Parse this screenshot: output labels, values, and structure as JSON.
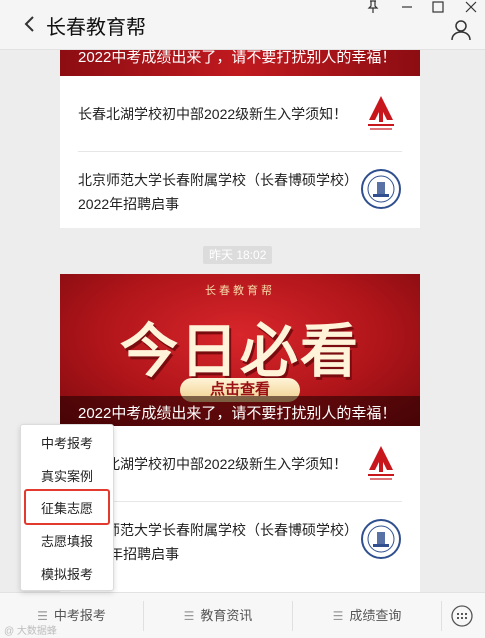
{
  "window": {
    "title": "长春教育帮"
  },
  "feed": {
    "top_banner_caption": "2022中考成绩出来了，请不要打扰别人的幸福！",
    "top_items": [
      {
        "title": "长春北湖学校初中部2022级新生入学须知！",
        "thumb": "school-logo-red"
      },
      {
        "title": "北京师范大学长春附属学校（长春博硕学校）2022年招聘启事",
        "thumb": "school-seal-blue"
      }
    ],
    "timestamp": "昨天  18:02",
    "hero": {
      "brand": "长春教育帮",
      "headline": "今日必看",
      "button": "点击查看",
      "caption": "2022中考成绩出来了，请不要打扰别人的幸福！"
    },
    "main_items": [
      {
        "title": "长春北湖学校初中部2022级新生入学须知！"
      },
      {
        "title": "北京师范大学长春附属学校（长春博硕学校）2022年招聘启事"
      }
    ]
  },
  "menu": {
    "tabs": [
      {
        "label": "中考报考"
      },
      {
        "label": "教育资讯"
      },
      {
        "label": "成绩查询"
      }
    ],
    "submenu": [
      {
        "label": "中考报考"
      },
      {
        "label": "真实案例"
      },
      {
        "label": "征集志愿"
      },
      {
        "label": "志愿填报"
      },
      {
        "label": "模拟报考"
      }
    ],
    "highlighted_item": "征集志愿"
  },
  "colors": {
    "accent_red": "#c01a1f",
    "highlight_border": "#e23a2e"
  },
  "watermark": "@ 大数据蜂"
}
